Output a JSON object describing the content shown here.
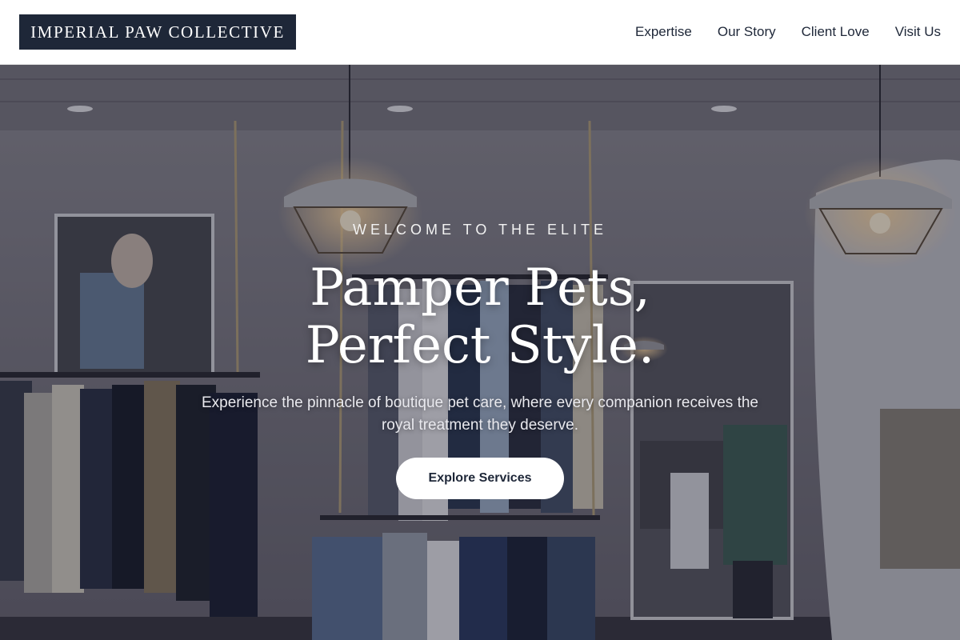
{
  "brand": {
    "name": "IMPERIAL PAW COLLECTIVE",
    "color": "#1e2738"
  },
  "nav": {
    "items": [
      {
        "label": "Expertise"
      },
      {
        "label": "Our Story"
      },
      {
        "label": "Client Love"
      },
      {
        "label": "Visit Us"
      }
    ]
  },
  "hero": {
    "eyebrow": "WELCOME TO THE ELITE",
    "headline_line1": "Pamper Pets,",
    "headline_line2": "Perfect Style.",
    "subtitle": "Experience the pinnacle of boutique pet care, where every companion receives the royal treatment they deserve.",
    "cta_label": "Explore Services",
    "background_image": "boutique-interior-photo"
  }
}
